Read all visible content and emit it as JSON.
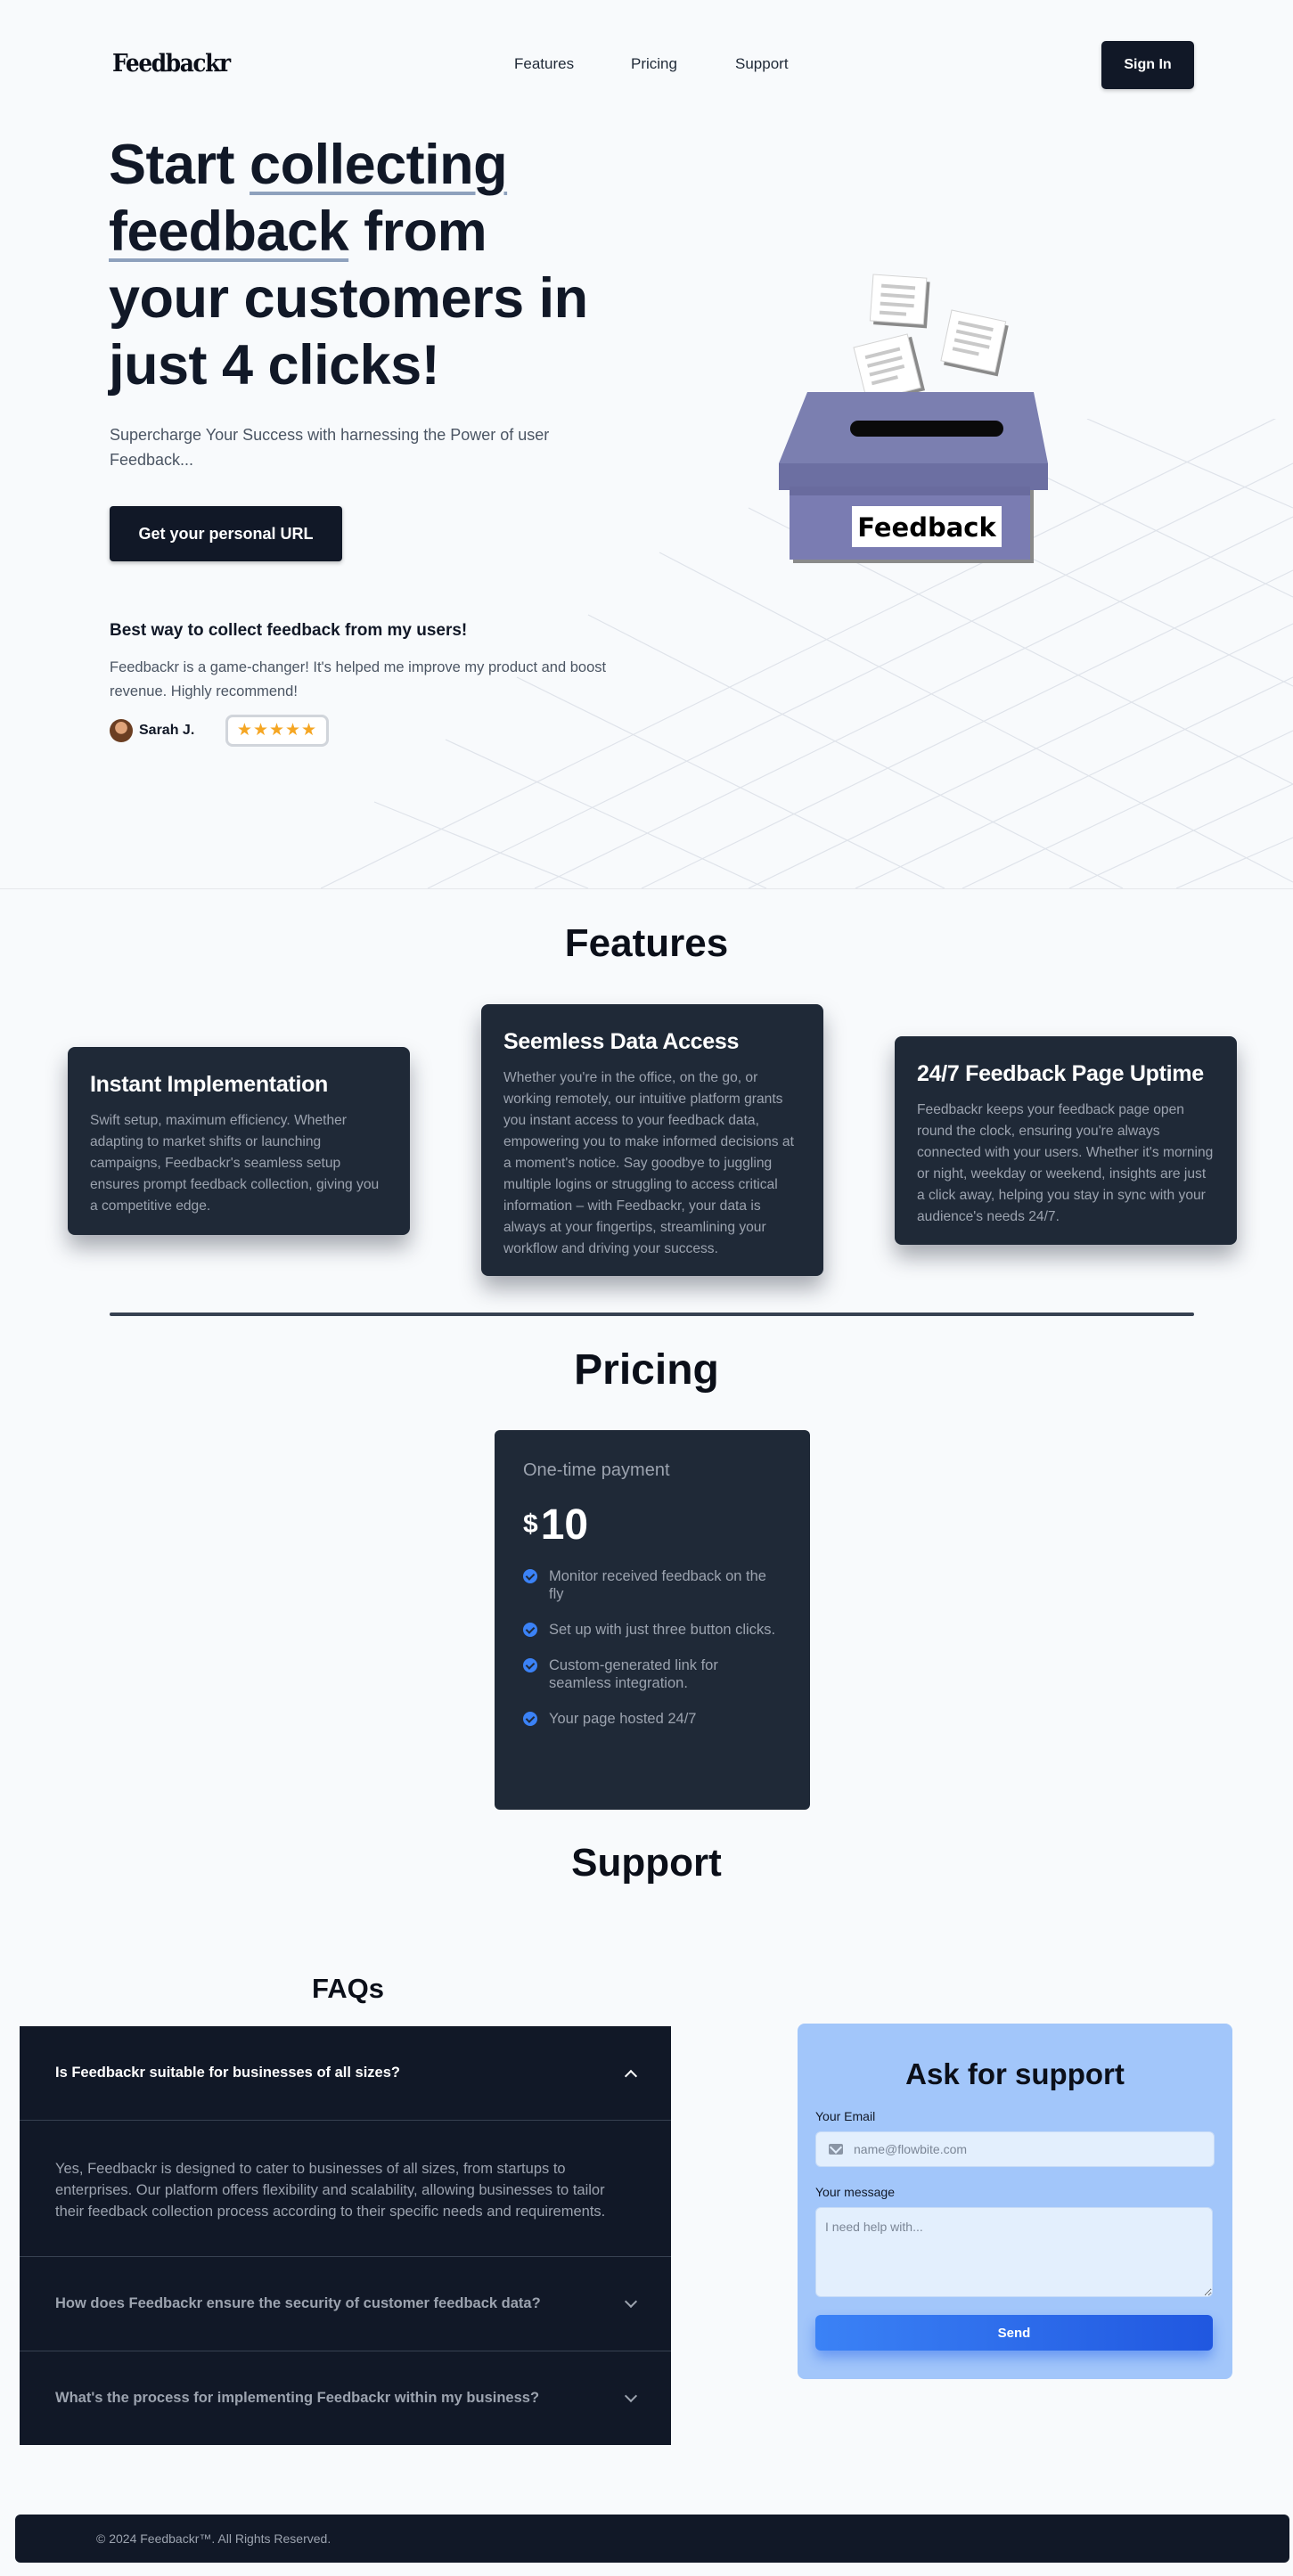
{
  "nav": {
    "logo": "Feedbackr",
    "links": [
      "Features",
      "Pricing",
      "Support"
    ],
    "signin_label": "Sign In"
  },
  "hero": {
    "title": {
      "part1": "Start ",
      "hl1": "collecting",
      "hl2": "feedback",
      "part2": " from your customers in just 4 clicks!"
    },
    "subtitle": "Supercharge Your Success with harnessing the Power of user Feedback...",
    "cta_label": "Get your personal URL",
    "illustration_label": "Feedback"
  },
  "testimonial": {
    "title": "Best way to collect feedback from my users!",
    "body": "Feedbackr is a game-changer! It's helped me improve my product and boost revenue. Highly recommend!",
    "name": "Sarah J.",
    "rating": 5,
    "stars": "★★★★★"
  },
  "features": {
    "title": "Features",
    "items": [
      {
        "title": "Instant Implementation",
        "body": "Swift setup, maximum efficiency. Whether adapting to market shifts or launching campaigns, Feedbackr's seamless setup ensures prompt feedback collection, giving you a competitive edge."
      },
      {
        "title": "Seemless Data Access",
        "body": "Whether you're in the office, on the go, or working remotely, our intuitive platform grants you instant access to your feedback data, empowering you to make informed decisions at a moment's notice. Say goodbye to juggling multiple logins or struggling to access critical information – with Feedbackr, your data is always at your fingertips, streamlining your workflow and driving your success."
      },
      {
        "title": "24/7 Feedback Page Uptime",
        "body": "Feedbackr keeps your feedback page open round the clock, ensuring you're always connected with your users. Whether it's morning or night, weekday or weekend, insights are just a click away, helping you stay in sync with your audience's needs 24/7."
      }
    ]
  },
  "pricing": {
    "title": "Pricing",
    "label": "One-time payment",
    "currency": "$",
    "amount": "10",
    "features": [
      "Monitor received feedback on the fly",
      "Set up with just three button clicks.",
      "Custom-generated link for seamless integration.",
      "Your page hosted 24/7"
    ]
  },
  "support": {
    "title": "Support",
    "faq_title": "FAQs",
    "faqs": [
      {
        "q": "Is Feedbackr suitable for businesses of all sizes?",
        "a": "Yes, Feedbackr is designed to cater to businesses of all sizes, from startups to enterprises. Our platform offers flexibility and scalability, allowing businesses to tailor their feedback collection process according to their specific needs and requirements."
      },
      {
        "q": "How does Feedbackr ensure the security of customer feedback data?"
      },
      {
        "q": "What's the process for implementing Feedbackr within my business?"
      }
    ],
    "form": {
      "title": "Ask for support",
      "email_label": "Your Email",
      "email_placeholder": "name@flowbite.com",
      "message_label": "Your message",
      "message_placeholder": "I need help with...",
      "send_label": "Send"
    }
  },
  "footer": {
    "copyright": "© 2024 Feedbackr™. All Rights Reserved."
  },
  "colors": {
    "dark": "#111827",
    "card": "#1f2937",
    "accent": "#3b82f6",
    "form_bg": "#a2c6fa",
    "star": "#f5a623",
    "box": "#7b7fb0"
  }
}
